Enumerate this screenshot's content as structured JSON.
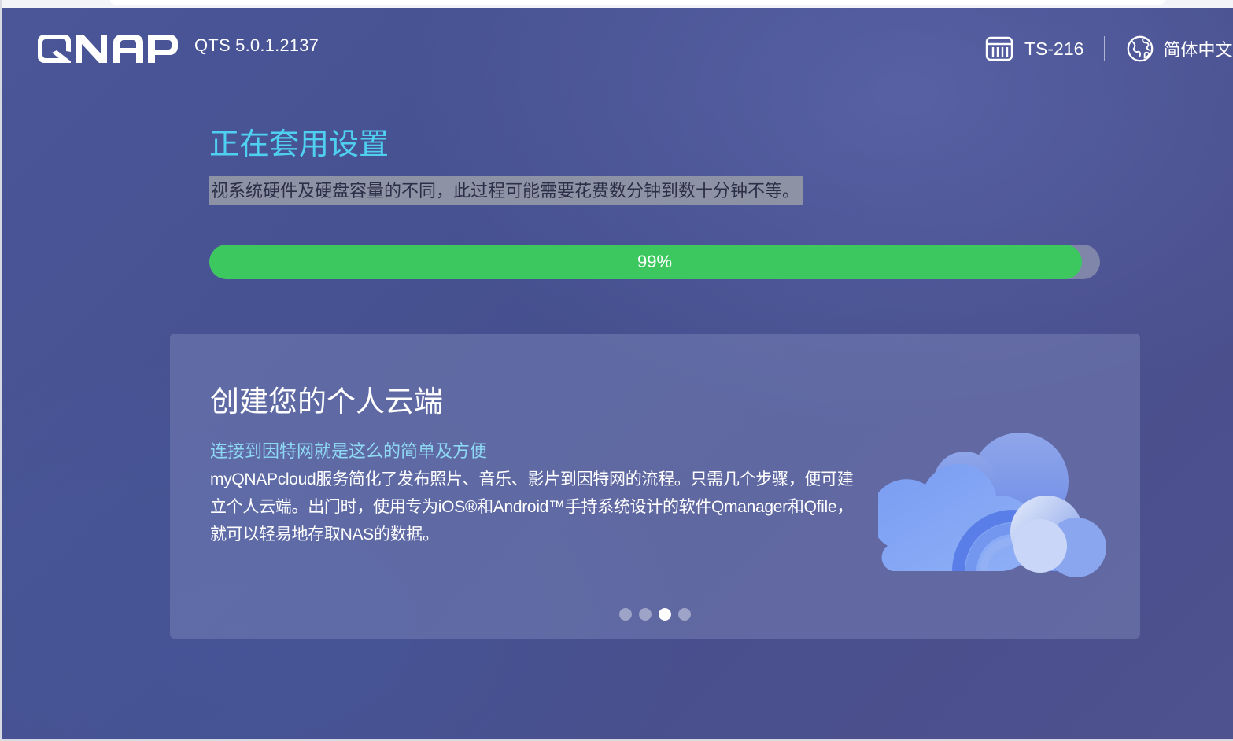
{
  "header": {
    "brand": "QNAP",
    "version": "QTS 5.0.1.2137",
    "device_name": "TS-216",
    "language": "简体中文",
    "icons": {
      "device": "nas-device-icon",
      "language": "globe-icon"
    }
  },
  "setup": {
    "title": "正在套用设置",
    "description": "视系统硬件及硬盘容量的不同，此过程可能需要花费数分钟到数十分钟不等。",
    "progress_percent": 99,
    "progress_label": "99%"
  },
  "card": {
    "title": "创建您的个人云端",
    "subtitle": "连接到因特网就是这么的简单及方便",
    "body": "myQNAPcloud服务简化了发布照片、音乐、影片到因特网的流程。只需几个步骤，便可建立个人云端。出门时，使用专为iOS®和Android™手持系统设计的软件Qmanager和Qfile，就可以轻易地存取NAS的数据。",
    "illustration": "cloud-illustration",
    "carousel": {
      "total": 4,
      "active_index": 2
    }
  },
  "colors": {
    "accent_title": "#4fd0f0",
    "subtitle": "#8ed8f4",
    "progress_fill": "#3cc85f",
    "progress_track": "#7f86a9"
  }
}
